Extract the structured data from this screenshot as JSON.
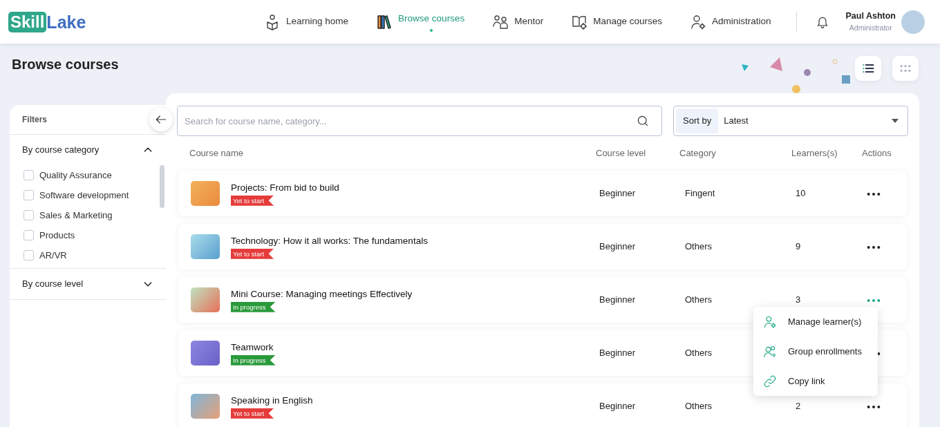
{
  "logo": {
    "part1": "Skill",
    "part2": "Lake"
  },
  "nav": [
    {
      "label": "Learning home",
      "selected": false
    },
    {
      "label": "Browse courses",
      "selected": true
    },
    {
      "label": "Mentor",
      "selected": false
    },
    {
      "label": "Manage courses",
      "selected": false
    },
    {
      "label": "Administration",
      "selected": false
    }
  ],
  "user": {
    "name": "Paul Ashton",
    "role": "Administrator"
  },
  "page_title": "Browse courses",
  "view_toggles": [
    {
      "kind": "list",
      "selected": true
    },
    {
      "kind": "grid",
      "selected": false
    }
  ],
  "filters": {
    "title": "Filters",
    "sections": [
      {
        "title": "By course category",
        "expanded": true,
        "options": [
          {
            "label": "Quality Assurance",
            "checked": false
          },
          {
            "label": "Software development",
            "checked": false
          },
          {
            "label": "Sales & Marketing",
            "checked": false
          },
          {
            "label": "Products",
            "checked": false
          },
          {
            "label": "AR/VR",
            "checked": false
          }
        ]
      },
      {
        "title": "By course level",
        "expanded": false
      }
    ]
  },
  "search": {
    "placeholder": "Search for course name, category..."
  },
  "sort": {
    "label": "Sort by",
    "value": "Latest"
  },
  "table": {
    "columns": [
      "Course name",
      "Course level",
      "Category",
      "Learners(s)",
      "Actions"
    ],
    "rows": [
      {
        "name": "Projects: From bid to build",
        "status": {
          "label": "Yet to start",
          "kind": "not_started"
        },
        "level": "Beginner",
        "category": "Fingent",
        "learners": "10",
        "menu_open": false
      },
      {
        "name": "Technology: How it all works: The fundamentals",
        "status": {
          "label": "Yet to start",
          "kind": "not_started"
        },
        "level": "Beginner",
        "category": "Others",
        "learners": "9",
        "menu_open": false
      },
      {
        "name": "Mini Course: Managing meetings Effectively",
        "status": {
          "label": "In progress",
          "kind": "in_progress"
        },
        "level": "Beginner",
        "category": "Others",
        "learners": "3",
        "menu_open": true
      },
      {
        "name": "Teamwork",
        "status": {
          "label": "In progress",
          "kind": "in_progress"
        },
        "level": "Beginner",
        "category": "Others",
        "menu_open": false
      },
      {
        "name": "Speaking in English",
        "status": {
          "label": "Yet to start",
          "kind": "not_started"
        },
        "level": "Beginner",
        "category": "Others",
        "learners": "2",
        "menu_open": false
      }
    ]
  },
  "action_menu": [
    {
      "label": "Manage learner(s)"
    },
    {
      "label": "Group enrollments"
    },
    {
      "label": "Copy link"
    }
  ]
}
